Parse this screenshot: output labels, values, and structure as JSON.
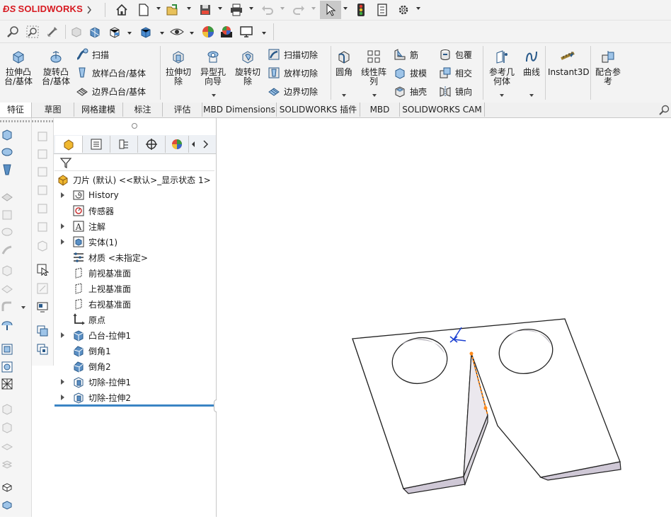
{
  "app": {
    "brand": "SOLIDWORKS",
    "brand_color": "#d71920"
  },
  "titlebar_icons": [
    "home-icon",
    "new-document-icon",
    "open-icon",
    "save-icon",
    "print-icon",
    "undo-icon",
    "redo-icon",
    "select-arrow-icon",
    "rebuild-icon",
    "file-properties-icon",
    "options-gear-icon"
  ],
  "commands": {
    "extrude_boss": "拉伸凸\n台/基体",
    "revolve_boss": "旋转凸\n台/基体",
    "sweep": "扫描",
    "loft_boss": "放样凸台/基体",
    "boundary_boss": "边界凸台/基体",
    "extrude_cut": "拉伸切\n除",
    "hole_wizard": "异型孔\n向导",
    "revolve_cut": "旋转切\n除",
    "sweep_cut": "扫描切除",
    "loft_cut": "放样切除",
    "boundary_cut": "边界切除",
    "fillet": "圆角",
    "linear_pattern": "线性阵\n列",
    "rib": "筋",
    "draft": "拔模",
    "shell": "抽壳",
    "wrap": "包覆",
    "intersect": "相交",
    "mirror": "镜向",
    "reference_geometry": "参考几\n何体",
    "curves": "曲线",
    "instant3d": "Instant3D",
    "mate_reference": "配合参\n考"
  },
  "tabs": [
    "特征",
    "草图",
    "网格建模",
    "标注",
    "评估",
    "MBD Dimensions",
    "SOLIDWORKS 插件",
    "MBD",
    "SOLIDWORKS CAM"
  ],
  "active_tab": "特征",
  "tree": {
    "root": "刀片 (默认) <<默认>_显示状态 1>",
    "items": [
      {
        "label": "History",
        "icon": "history-icon",
        "expandable": true
      },
      {
        "label": "传感器",
        "icon": "sensor-icon",
        "expandable": false
      },
      {
        "label": "注解",
        "icon": "annotation-icon",
        "expandable": true
      },
      {
        "label": "实体(1)",
        "icon": "solid-body-icon",
        "expandable": true
      },
      {
        "label": "材质 <未指定>",
        "icon": "material-icon",
        "expandable": false
      },
      {
        "label": "前视基准面",
        "icon": "plane-icon",
        "expandable": false
      },
      {
        "label": "上视基准面",
        "icon": "plane-icon",
        "expandable": false
      },
      {
        "label": "右视基准面",
        "icon": "plane-icon",
        "expandable": false
      },
      {
        "label": "原点",
        "icon": "origin-icon",
        "expandable": false
      },
      {
        "label": "凸台-拉伸1",
        "icon": "extrude-feature-icon",
        "expandable": true
      },
      {
        "label": "倒角1",
        "icon": "chamfer-icon",
        "expandable": false
      },
      {
        "label": "倒角2",
        "icon": "chamfer-icon",
        "expandable": false
      },
      {
        "label": "切除-拉伸1",
        "icon": "cut-extrude-icon",
        "expandable": true
      },
      {
        "label": "切除-拉伸2",
        "icon": "cut-extrude-icon",
        "expandable": true
      }
    ]
  },
  "colors": {
    "accent": "#3b84c4",
    "rollback_bar": "#3b84c4",
    "model_face": "#ffffff",
    "model_side": "#d8d4dc"
  }
}
